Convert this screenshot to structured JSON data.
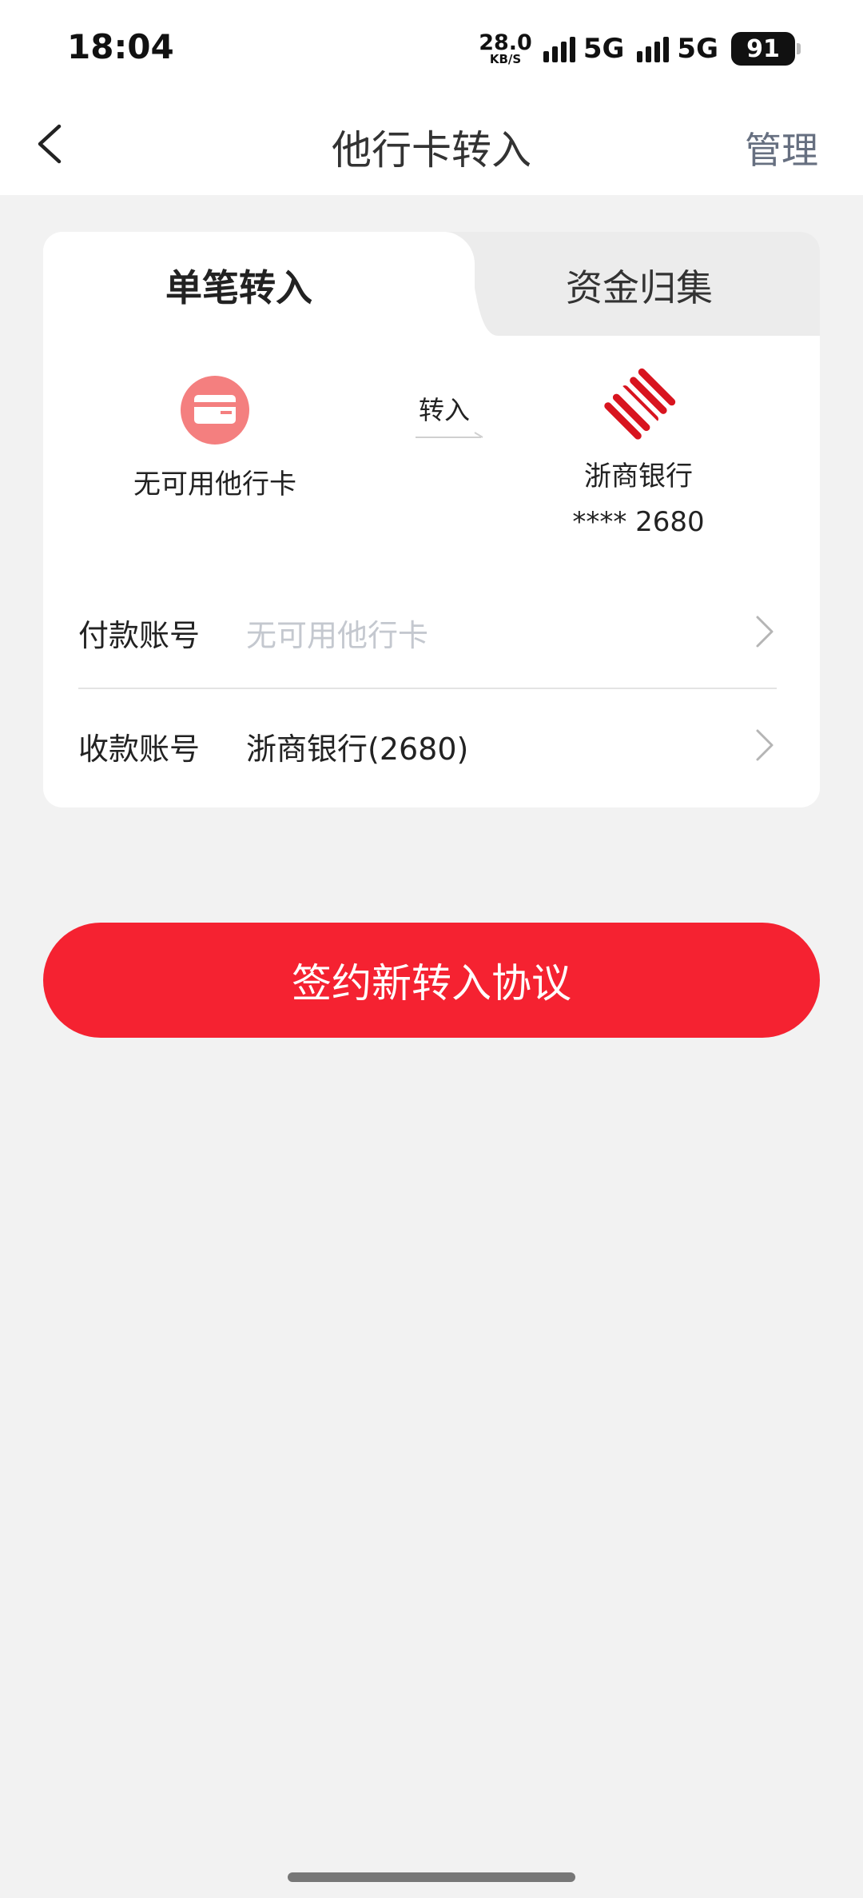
{
  "status": {
    "time": "18:04",
    "net_speed": "28.0",
    "net_speed_unit": "KB/S",
    "network_1": "5G",
    "network_2": "5G",
    "battery": "91"
  },
  "nav": {
    "title": "他行卡转入",
    "action": "管理"
  },
  "tabs": [
    {
      "label": "单笔转入",
      "active": true
    },
    {
      "label": "资金归集",
      "active": false
    }
  ],
  "transfer": {
    "from_label": "无可用他行卡",
    "arrow_label": "转入",
    "to_bank": "浙商银行",
    "to_number": "**** 2680"
  },
  "payer": {
    "label": "付款账号",
    "placeholder": "无可用他行卡"
  },
  "payee": {
    "label": "收款账号",
    "value": "浙商银行(2680)"
  },
  "sign_button": "签约新转入协议",
  "colors": {
    "accent": "#f52231",
    "card_icon": "#f47f7f",
    "bank_red": "#d8141f"
  }
}
